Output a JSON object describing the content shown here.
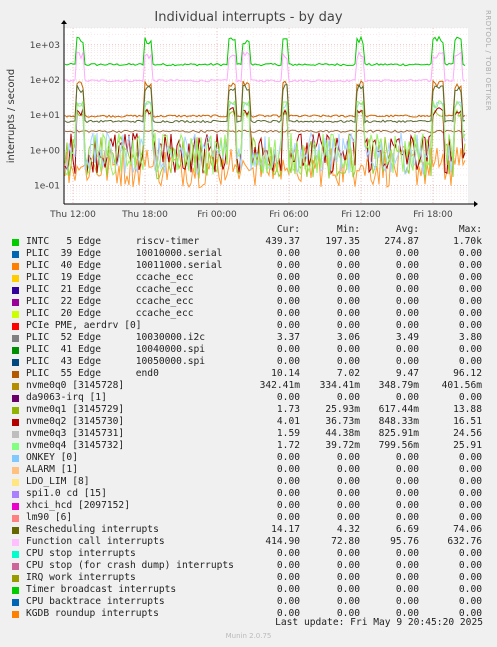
{
  "title": "Individual interrupts - by day",
  "watermark": "RRDTOOL / TOBI OETIKER",
  "chart_data": {
    "type": "line",
    "title": "Individual interrupts - by day",
    "ylabel": "interrupts / second",
    "yscale": "log",
    "ylim": [
      0.03,
      3000
    ],
    "yticks": [
      {
        "value": 0.1,
        "label": "1e-01"
      },
      {
        "value": 1,
        "label": "1e+00"
      },
      {
        "value": 10,
        "label": "1e+01"
      },
      {
        "value": 100,
        "label": "1e+02"
      },
      {
        "value": 1000,
        "label": "1e+03"
      }
    ],
    "xticks": [
      "Thu 12:00",
      "Thu 18:00",
      "Fri 00:00",
      "Fri 06:00",
      "Fri 12:00",
      "Fri 18:00"
    ],
    "grid": true,
    "series": [
      {
        "name": "INTC 5 Edge riscv-timer",
        "color": "#00cc00",
        "baseline": 274.87,
        "spike": 1700
      },
      {
        "name": "Function call interrupts",
        "color": "#ffaaff",
        "baseline": 95.76,
        "spike": 632.76
      },
      {
        "name": "PLIC 55 Edge end0",
        "color": "#cc6600",
        "baseline": 9.47,
        "spike": 96.12
      },
      {
        "name": "nvme0q0 [3145728]",
        "color": "#ff9933",
        "baseline": 0.34879,
        "spike": 0.40156
      },
      {
        "name": "PLIC 52 Edge 10030000.i2c",
        "color": "#996633",
        "baseline": 3.49,
        "spike": 3.8
      },
      {
        "name": "Rescheduling interrupts",
        "color": "#556b2f",
        "baseline": 6.69,
        "spike": 74.06
      },
      {
        "name": "nvme0q1 [3145729]",
        "color": "#99cc33",
        "baseline": 0.617,
        "spike": 13.88
      },
      {
        "name": "nvme0q2 [3145730]",
        "color": "#aa0000",
        "baseline": 0.848,
        "spike": 16.51
      },
      {
        "name": "nvme0q3 [3145731]",
        "color": "#aad4ff",
        "baseline": 0.826,
        "spike": 24.56
      },
      {
        "name": "nvme0q4 [3145732]",
        "color": "#99ee66",
        "baseline": 0.8,
        "spike": 25.91
      }
    ]
  },
  "legend": {
    "headers": {
      "cur": "Cur:",
      "min": "Min:",
      "avg": "Avg:",
      "max": "Max:"
    },
    "rows": [
      {
        "color": "#00cc00",
        "label": "INTC   5 Edge      riscv-timer",
        "cur": "439.37",
        "min": "197.35",
        "avg": "274.87",
        "max": "1.70k"
      },
      {
        "color": "#0066b3",
        "label": "PLIC  39 Edge      10010000.serial",
        "cur": "0.00",
        "min": "0.00",
        "avg": "0.00",
        "max": "0.00"
      },
      {
        "color": "#ff8000",
        "label": "PLIC  40 Edge      10011000.serial",
        "cur": "0.00",
        "min": "0.00",
        "avg": "0.00",
        "max": "0.00"
      },
      {
        "color": "#ffcc00",
        "label": "PLIC  19 Edge      ccache_ecc",
        "cur": "0.00",
        "min": "0.00",
        "avg": "0.00",
        "max": "0.00"
      },
      {
        "color": "#330099",
        "label": "PLIC  21 Edge      ccache_ecc",
        "cur": "0.00",
        "min": "0.00",
        "avg": "0.00",
        "max": "0.00"
      },
      {
        "color": "#990099",
        "label": "PLIC  22 Edge      ccache_ecc",
        "cur": "0.00",
        "min": "0.00",
        "avg": "0.00",
        "max": "0.00"
      },
      {
        "color": "#ccff00",
        "label": "PLIC  20 Edge      ccache_ecc",
        "cur": "0.00",
        "min": "0.00",
        "avg": "0.00",
        "max": "0.00"
      },
      {
        "color": "#ff0000",
        "label": "PCIe PME, aerdrv [0]",
        "cur": "0.00",
        "min": "0.00",
        "avg": "0.00",
        "max": "0.00"
      },
      {
        "color": "#808080",
        "label": "PLIC  52 Edge      10030000.i2c",
        "cur": "3.37",
        "min": "3.06",
        "avg": "3.49",
        "max": "3.80"
      },
      {
        "color": "#008f00",
        "label": "PLIC  41 Edge      10040000.spi",
        "cur": "0.00",
        "min": "0.00",
        "avg": "0.00",
        "max": "0.00"
      },
      {
        "color": "#00487d",
        "label": "PLIC  43 Edge      10050000.spi",
        "cur": "0.00",
        "min": "0.00",
        "avg": "0.00",
        "max": "0.00"
      },
      {
        "color": "#b35a00",
        "label": "PLIC  55 Edge      end0",
        "cur": "10.14",
        "min": "7.02",
        "avg": "9.47",
        "max": "96.12"
      },
      {
        "color": "#b38f00",
        "label": "nvme0q0 [3145728]",
        "cur": "342.41m",
        "min": "334.41m",
        "avg": "348.79m",
        "max": "401.56m"
      },
      {
        "color": "#6b006b",
        "label": "da9063-irq [1]",
        "cur": "0.00",
        "min": "0.00",
        "avg": "0.00",
        "max": "0.00"
      },
      {
        "color": "#8fb300",
        "label": "nvme0q1 [3145729]",
        "cur": "1.73",
        "min": "25.93m",
        "avg": "617.44m",
        "max": "13.88"
      },
      {
        "color": "#b30000",
        "label": "nvme0q2 [3145730]",
        "cur": "4.01",
        "min": "36.73m",
        "avg": "848.33m",
        "max": "16.51"
      },
      {
        "color": "#bebebe",
        "label": "nvme0q3 [3145731]",
        "cur": "1.59",
        "min": "44.38m",
        "avg": "825.91m",
        "max": "24.56"
      },
      {
        "color": "#80ff80",
        "label": "nvme0q4 [3145732]",
        "cur": "1.72",
        "min": "39.72m",
        "avg": "799.56m",
        "max": "25.91"
      },
      {
        "color": "#80c9ff",
        "label": "ONKEY [0]",
        "cur": "0.00",
        "min": "0.00",
        "avg": "0.00",
        "max": "0.00"
      },
      {
        "color": "#ffc080",
        "label": "ALARM [1]",
        "cur": "0.00",
        "min": "0.00",
        "avg": "0.00",
        "max": "0.00"
      },
      {
        "color": "#ffe680",
        "label": "LDO_LIM [8]",
        "cur": "0.00",
        "min": "0.00",
        "avg": "0.00",
        "max": "0.00"
      },
      {
        "color": "#aa80ff",
        "label": "spi1.0 cd [15]",
        "cur": "0.00",
        "min": "0.00",
        "avg": "0.00",
        "max": "0.00"
      },
      {
        "color": "#ee00cc",
        "label": "xhci_hcd [2097152]",
        "cur": "0.00",
        "min": "0.00",
        "avg": "0.00",
        "max": "0.00"
      },
      {
        "color": "#ff8080",
        "label": "lm90 [6]",
        "cur": "0.00",
        "min": "0.00",
        "avg": "0.00",
        "max": "0.00"
      },
      {
        "color": "#666600",
        "label": "Rescheduling interrupts",
        "cur": "14.17",
        "min": "4.32",
        "avg": "6.69",
        "max": "74.06"
      },
      {
        "color": "#ffbfff",
        "label": "Function call interrupts",
        "cur": "414.90",
        "min": "72.80",
        "avg": "95.76",
        "max": "632.76"
      },
      {
        "color": "#00ffcc",
        "label": "CPU stop interrupts",
        "cur": "0.00",
        "min": "0.00",
        "avg": "0.00",
        "max": "0.00"
      },
      {
        "color": "#cc6699",
        "label": "CPU stop (for crash dump) interrupts",
        "cur": "0.00",
        "min": "0.00",
        "avg": "0.00",
        "max": "0.00"
      },
      {
        "color": "#999900",
        "label": "IRQ work interrupts",
        "cur": "0.00",
        "min": "0.00",
        "avg": "0.00",
        "max": "0.00"
      },
      {
        "color": "#00cc00",
        "label": "Timer broadcast interrupts",
        "cur": "0.00",
        "min": "0.00",
        "avg": "0.00",
        "max": "0.00"
      },
      {
        "color": "#0066b3",
        "label": "CPU backtrace interrupts",
        "cur": "0.00",
        "min": "0.00",
        "avg": "0.00",
        "max": "0.00"
      },
      {
        "color": "#ff8000",
        "label": "KGDB roundup interrupts",
        "cur": "0.00",
        "min": "0.00",
        "avg": "0.00",
        "max": "0.00"
      }
    ]
  },
  "footer": {
    "last_update": "Last update: Fri May  9 20:45:20 2025",
    "munin": "Munin 2.0.75"
  }
}
